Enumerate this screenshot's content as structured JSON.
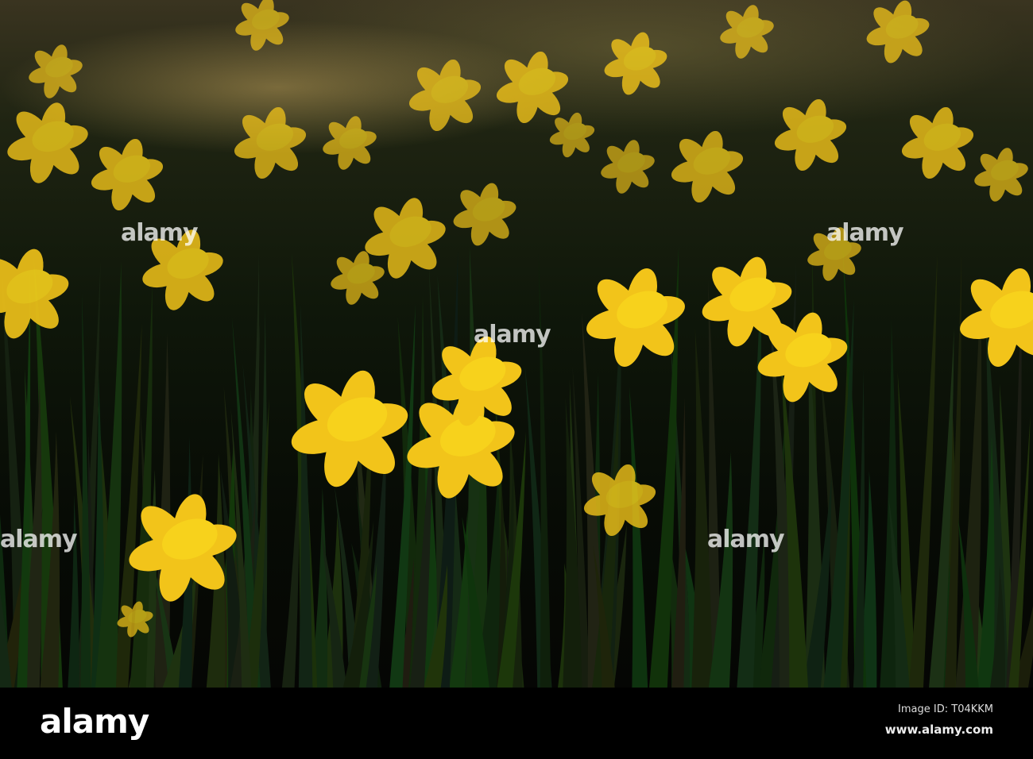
{
  "watermark": {
    "text": "alamy",
    "icon": "alamy-a-icon"
  },
  "footer": {
    "logo": "alamy",
    "image_id": "Image ID: T04KKM",
    "website": "www.alamy.com"
  },
  "colors": {
    "petal": "#f2c41a",
    "trumpet": "#f7d21c",
    "foliage": "#0f1a0b",
    "background": "#000000"
  }
}
